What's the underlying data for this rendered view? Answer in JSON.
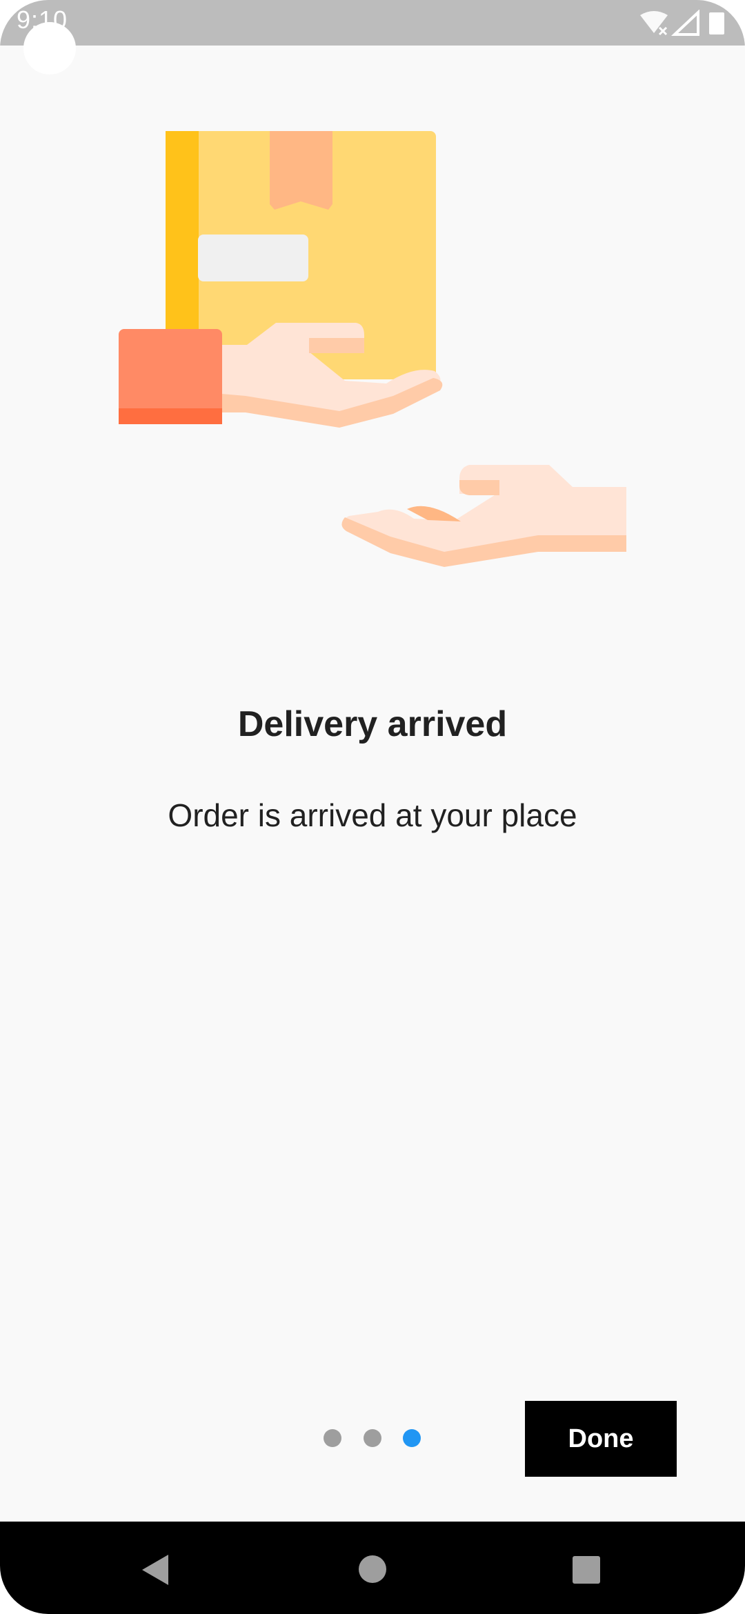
{
  "status_bar": {
    "time": "9:10"
  },
  "onboarding": {
    "title": "Delivery arrived",
    "subtitle": "Order is arrived at your place",
    "done_label": "Done",
    "pages_total": 3,
    "current_page": 3
  },
  "colors": {
    "accent": "#2196f3",
    "inactive_dot": "#9e9e9e",
    "done_bg": "#000000",
    "background": "#f9f9f9"
  },
  "icons": {
    "nav_back": "back-triangle-icon",
    "nav_home": "home-circle-icon",
    "nav_recents": "recents-square-icon",
    "wifi": "wifi-off-icon",
    "signal": "signal-icon",
    "battery": "battery-icon"
  }
}
